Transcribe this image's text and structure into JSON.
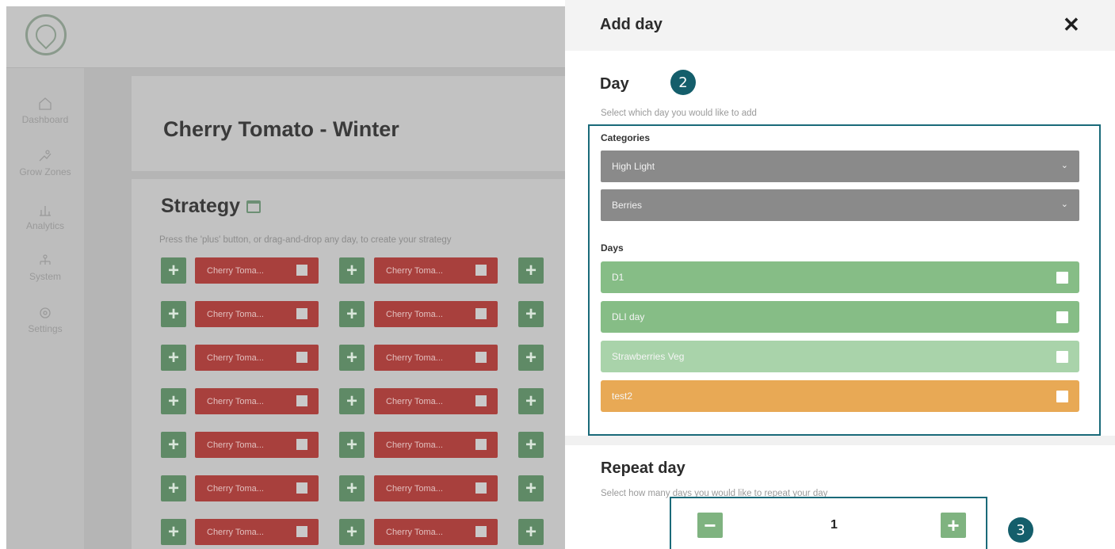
{
  "app": {
    "page_title": "Cherry Tomato - Winter",
    "nav": [
      "Dashboard",
      "Grow Zones",
      "Analytics",
      "System",
      "Settings"
    ],
    "strategy": {
      "title": "Strategy",
      "subtitle": "Press the 'plus' button, or drag-and-drop any day, to create your strategy",
      "chip_label": "Cherry Toma..."
    }
  },
  "panel": {
    "title": "Add day",
    "close": "✕",
    "day_section": {
      "title": "Day",
      "subtitle": "Select which day you would like to add",
      "categories_label": "Categories",
      "category_selects": [
        "High Light",
        "Berries"
      ],
      "days_label": "Days",
      "days": [
        {
          "name": "D1",
          "color": "#86bd86"
        },
        {
          "name": "DLI day",
          "color": "#86bd86"
        },
        {
          "name": "Strawberries Veg",
          "color": "#a9d3aa"
        },
        {
          "name": "test2",
          "color": "#e8a955"
        }
      ]
    },
    "repeat_section": {
      "title": "Repeat day",
      "subtitle": "Select how many days you would like to repeat your day",
      "value": "1"
    },
    "badges": [
      "2",
      "3"
    ]
  },
  "colors": {
    "accent_outline": "#1a6a79",
    "badge": "#145e6b",
    "plus_green": "#5f8a66",
    "chip_red": "#a8403d"
  }
}
